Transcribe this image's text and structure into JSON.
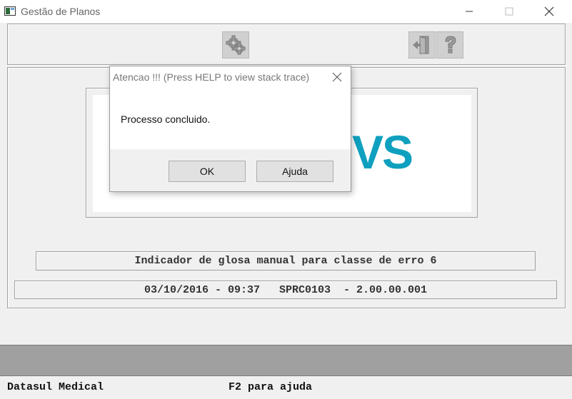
{
  "window": {
    "title": "Gestão de Planos",
    "icon": "app-window-icon",
    "controls": [
      "minimize-icon",
      "maximize-icon",
      "close-icon"
    ]
  },
  "toolbar": {
    "icons": [
      "gear-icon",
      "exit-door-icon",
      "help-question-icon"
    ]
  },
  "logo": {
    "visible_text": "VS",
    "color": "#0fa0bf"
  },
  "program": {
    "description": "Indicador de glosa manual para classe de erro 6",
    "info": "03/10/2016 - 09:37   SPRC0103  - 2.00.00.001"
  },
  "status_bar": {
    "left": "Datasul Medical",
    "right": "F2 para ajuda"
  },
  "dialog": {
    "title": "Atencao !!! (Press HELP to view stack trace)",
    "message": "Processo concluido.",
    "ok_label": "OK",
    "help_label": "Ajuda"
  }
}
